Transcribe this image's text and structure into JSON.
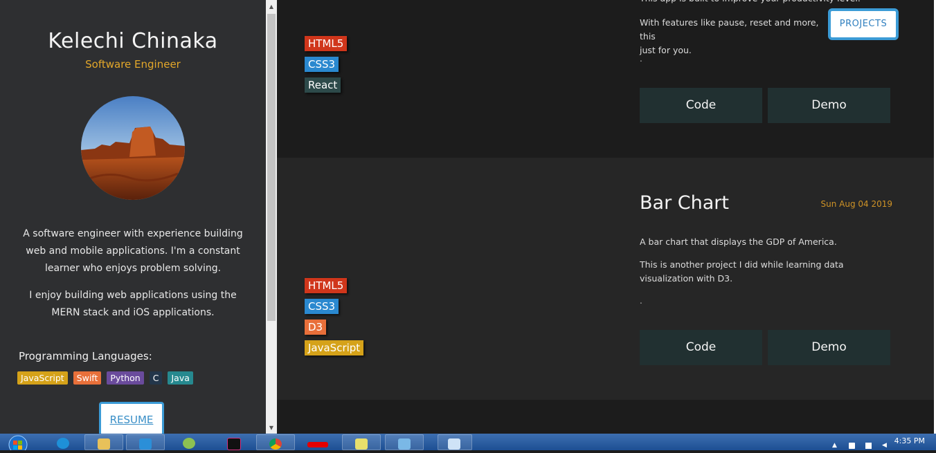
{
  "sidebar": {
    "name": "Kelechi Chinaka",
    "role": "Software Engineer",
    "bio_1": "A software engineer with experience building web and mobile applications. I'm a constant learner who enjoys problem solving.",
    "bio_2": "I enjoy building web applications using the MERN stack and iOS applications.",
    "languages_title": "Programming Languages:",
    "languages": [
      {
        "label": "JavaScript",
        "color": "#d5a219"
      },
      {
        "label": "Swift",
        "color": "#e8703a"
      },
      {
        "label": "Python",
        "color": "#6a4b9c"
      },
      {
        "label": "C",
        "color": "#23364a"
      },
      {
        "label": "Java",
        "color": "#26898f"
      }
    ],
    "resume_label": "RESUME"
  },
  "nav": {
    "projects_label": "PROJECTS"
  },
  "projects": [
    {
      "title_partial": "This app is built to improve your productivity level.",
      "desc_2": "With features like pause, reset and more, this",
      "desc_2_cont": "just for you.",
      "dot": ".",
      "tags": [
        "HTML5",
        "CSS3",
        "React"
      ],
      "code_label": "Code",
      "demo_label": "Demo"
    },
    {
      "title": "Bar Chart",
      "date": "Sun Aug 04 2019",
      "desc_1": "A bar chart that displays the GDP of America.",
      "desc_2": "This is another project I did while learning data visualization with D3.",
      "dot": ".",
      "tags": [
        "HTML5",
        "CSS3",
        "D3",
        "JavaScript"
      ],
      "code_label": "Code",
      "demo_label": "Demo"
    }
  ],
  "taskbar": {
    "clock": "4:35 PM",
    "apps": [
      "internet-explorer",
      "file-explorer",
      "vscode",
      "android-studio",
      "intellij",
      "chrome",
      "airtel",
      "sticky-notes",
      "app-generic",
      "task-view"
    ]
  },
  "colors": {
    "accent_blue": "#3b9bd6",
    "accent_orange": "#e4a82a",
    "button_bg": "#213031"
  }
}
